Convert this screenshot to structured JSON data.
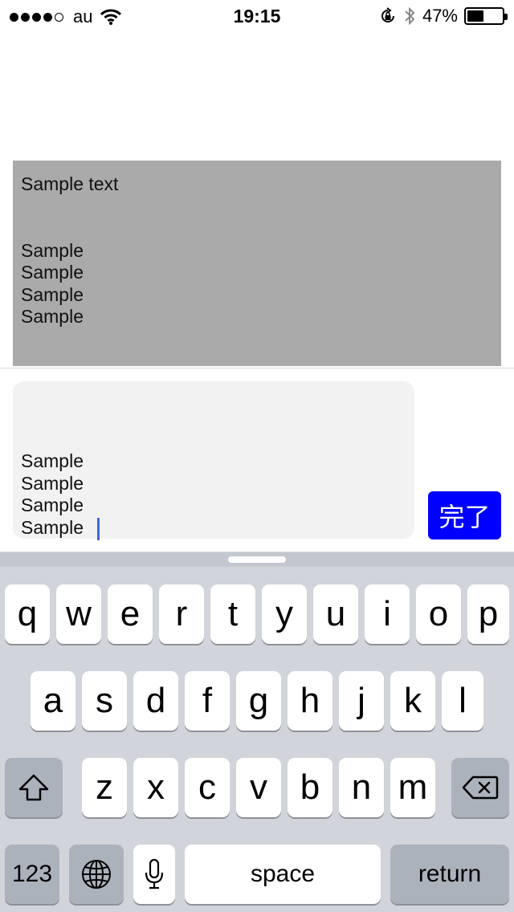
{
  "status_bar": {
    "carrier": "au",
    "time": "19:15",
    "battery_percent_text": "47%",
    "battery_level": 0.47,
    "signal_bars_filled": 4,
    "signal_bars_total": 5
  },
  "display_text": {
    "first_line": "Sample text",
    "lines": [
      "Sample",
      "Sample",
      "Sample",
      "Sample"
    ]
  },
  "input": {
    "lines": [
      "Sample",
      "Sample",
      "Sample",
      "Sample"
    ],
    "done_label": "完了"
  },
  "keyboard": {
    "row1": [
      "q",
      "w",
      "e",
      "r",
      "t",
      "y",
      "u",
      "i",
      "o",
      "p"
    ],
    "row2": [
      "a",
      "s",
      "d",
      "f",
      "g",
      "h",
      "j",
      "k",
      "l"
    ],
    "row3": [
      "z",
      "x",
      "c",
      "v",
      "b",
      "n",
      "m"
    ],
    "numbers_label": "123",
    "space_label": "space",
    "return_label": "return",
    "icons": {
      "shift": "shift-icon",
      "delete": "backspace-icon",
      "globe": "globe-icon",
      "mic": "microphone-icon"
    }
  },
  "colors": {
    "panel_gray": "#aaaaaa",
    "done_button": "#0000ff",
    "caret": "#3a6bd9"
  }
}
